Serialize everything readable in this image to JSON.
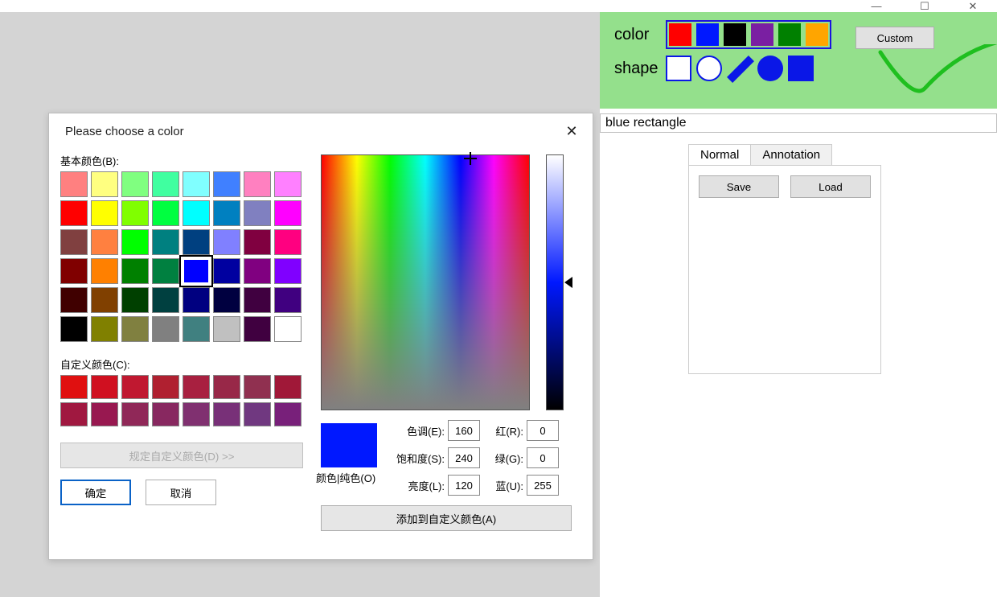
{
  "window": {
    "minimize": "—",
    "maximize": "☐",
    "close": "✕"
  },
  "right_panel": {
    "color_label": "color",
    "shape_label": "shape",
    "custom_btn": "Custom",
    "color_swatches": [
      "#ff0000",
      "#0018ff",
      "#000000",
      "#7a1fa2",
      "#008000",
      "#ffa500"
    ],
    "status_text": "blue rectangle",
    "tabs": {
      "normal": "Normal",
      "annotation": "Annotation",
      "active": "normal"
    },
    "save_btn": "Save",
    "load_btn": "Load"
  },
  "dialog": {
    "title": "Please choose a color",
    "basic_label": "基本颜色(B):",
    "custom_label": "自定义颜色(C):",
    "define_btn": "规定自定义颜色(D) >>",
    "ok": "确定",
    "cancel": "取消",
    "add_to_custom": "添加到自定义颜色(A)",
    "solid_label": "颜色|纯色(O)",
    "fields": {
      "hue_label": "色调(E):",
      "hue": "160",
      "sat_label": "饱和度(S):",
      "sat": "240",
      "lum_label": "亮度(L):",
      "lum": "120",
      "r_label": "红(R):",
      "r": "0",
      "g_label": "绿(G):",
      "g": "0",
      "b_label": "蓝(U):",
      "b": "255"
    },
    "basic_colors": [
      "#ff8080",
      "#ffff80",
      "#80ff80",
      "#40ffa0",
      "#80ffff",
      "#4080ff",
      "#ff80c0",
      "#ff80ff",
      "#ff0000",
      "#ffff00",
      "#80ff00",
      "#00ff40",
      "#00ffff",
      "#0080c0",
      "#8080c0",
      "#ff00ff",
      "#804040",
      "#ff8040",
      "#00ff00",
      "#008080",
      "#004080",
      "#8080ff",
      "#800040",
      "#ff0080",
      "#800000",
      "#ff8000",
      "#008000",
      "#008040",
      "#0000ff",
      "#0000a0",
      "#800080",
      "#8000ff",
      "#400000",
      "#804000",
      "#004000",
      "#004040",
      "#000080",
      "#000040",
      "#400040",
      "#400080",
      "#000000",
      "#808000",
      "#808040",
      "#808080",
      "#408080",
      "#c0c0c0",
      "#400040",
      "#ffffff"
    ],
    "selected_basic_index": 28,
    "custom_colors": [
      "#e01010",
      "#d01020",
      "#c01830",
      "#b02030",
      "#a82040",
      "#982848",
      "#903050",
      "#a01838",
      "#a01840",
      "#981850",
      "#902858",
      "#882860",
      "#803070",
      "#783078",
      "#703880",
      "#78207a"
    ]
  }
}
